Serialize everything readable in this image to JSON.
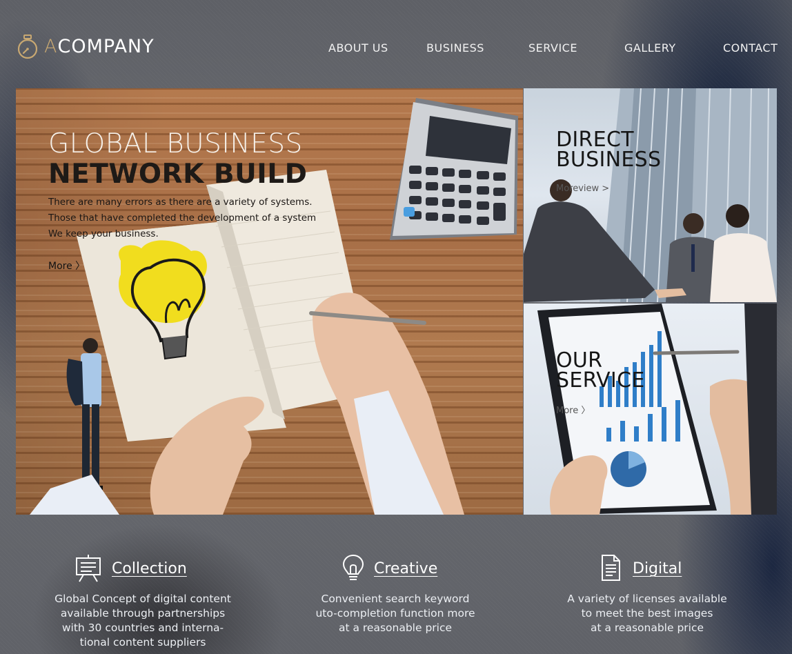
{
  "brand": {
    "name_first": "A",
    "name_rest": "COMPANY",
    "accent_color": "#c8a872",
    "icon": "stopwatch-icon"
  },
  "nav": {
    "items": [
      {
        "label": "ABOUT US"
      },
      {
        "label": "BUSINESS"
      },
      {
        "label": "SERVICE"
      },
      {
        "label": "GALLERY"
      },
      {
        "label": "CONTACT"
      }
    ]
  },
  "hero": {
    "title_line1": "GLOBAL BUSINESS",
    "title_line2": "NETWORK BUILD",
    "description": [
      "There are many errors as there are a variety of systems.",
      "Those that have completed the development of a system",
      "We keep your business."
    ],
    "more_label": "More 〉"
  },
  "cards": {
    "direct": {
      "title_line1": "DIRECT",
      "title_line2": "BUSINESS",
      "more_label": "Moreview  >"
    },
    "service": {
      "title_line1": "OUR",
      "title_line2": "SERVICE",
      "more_label": "More 〉"
    }
  },
  "features": [
    {
      "icon": "presentation-board-icon",
      "title": "Collection",
      "description": [
        "Global Concept of digital content",
        "available through partnerships",
        "with 30 countries and interna-",
        "tional content suppliers"
      ]
    },
    {
      "icon": "lightbulb-icon",
      "title": "Creative",
      "description": [
        "Convenient search keyword",
        "uto-completion function more",
        "at a reasonable price"
      ]
    },
    {
      "icon": "document-icon",
      "title": "Digital",
      "description": [
        "A variety of licenses available",
        "to meet the best images",
        "at a reasonable price"
      ]
    }
  ]
}
